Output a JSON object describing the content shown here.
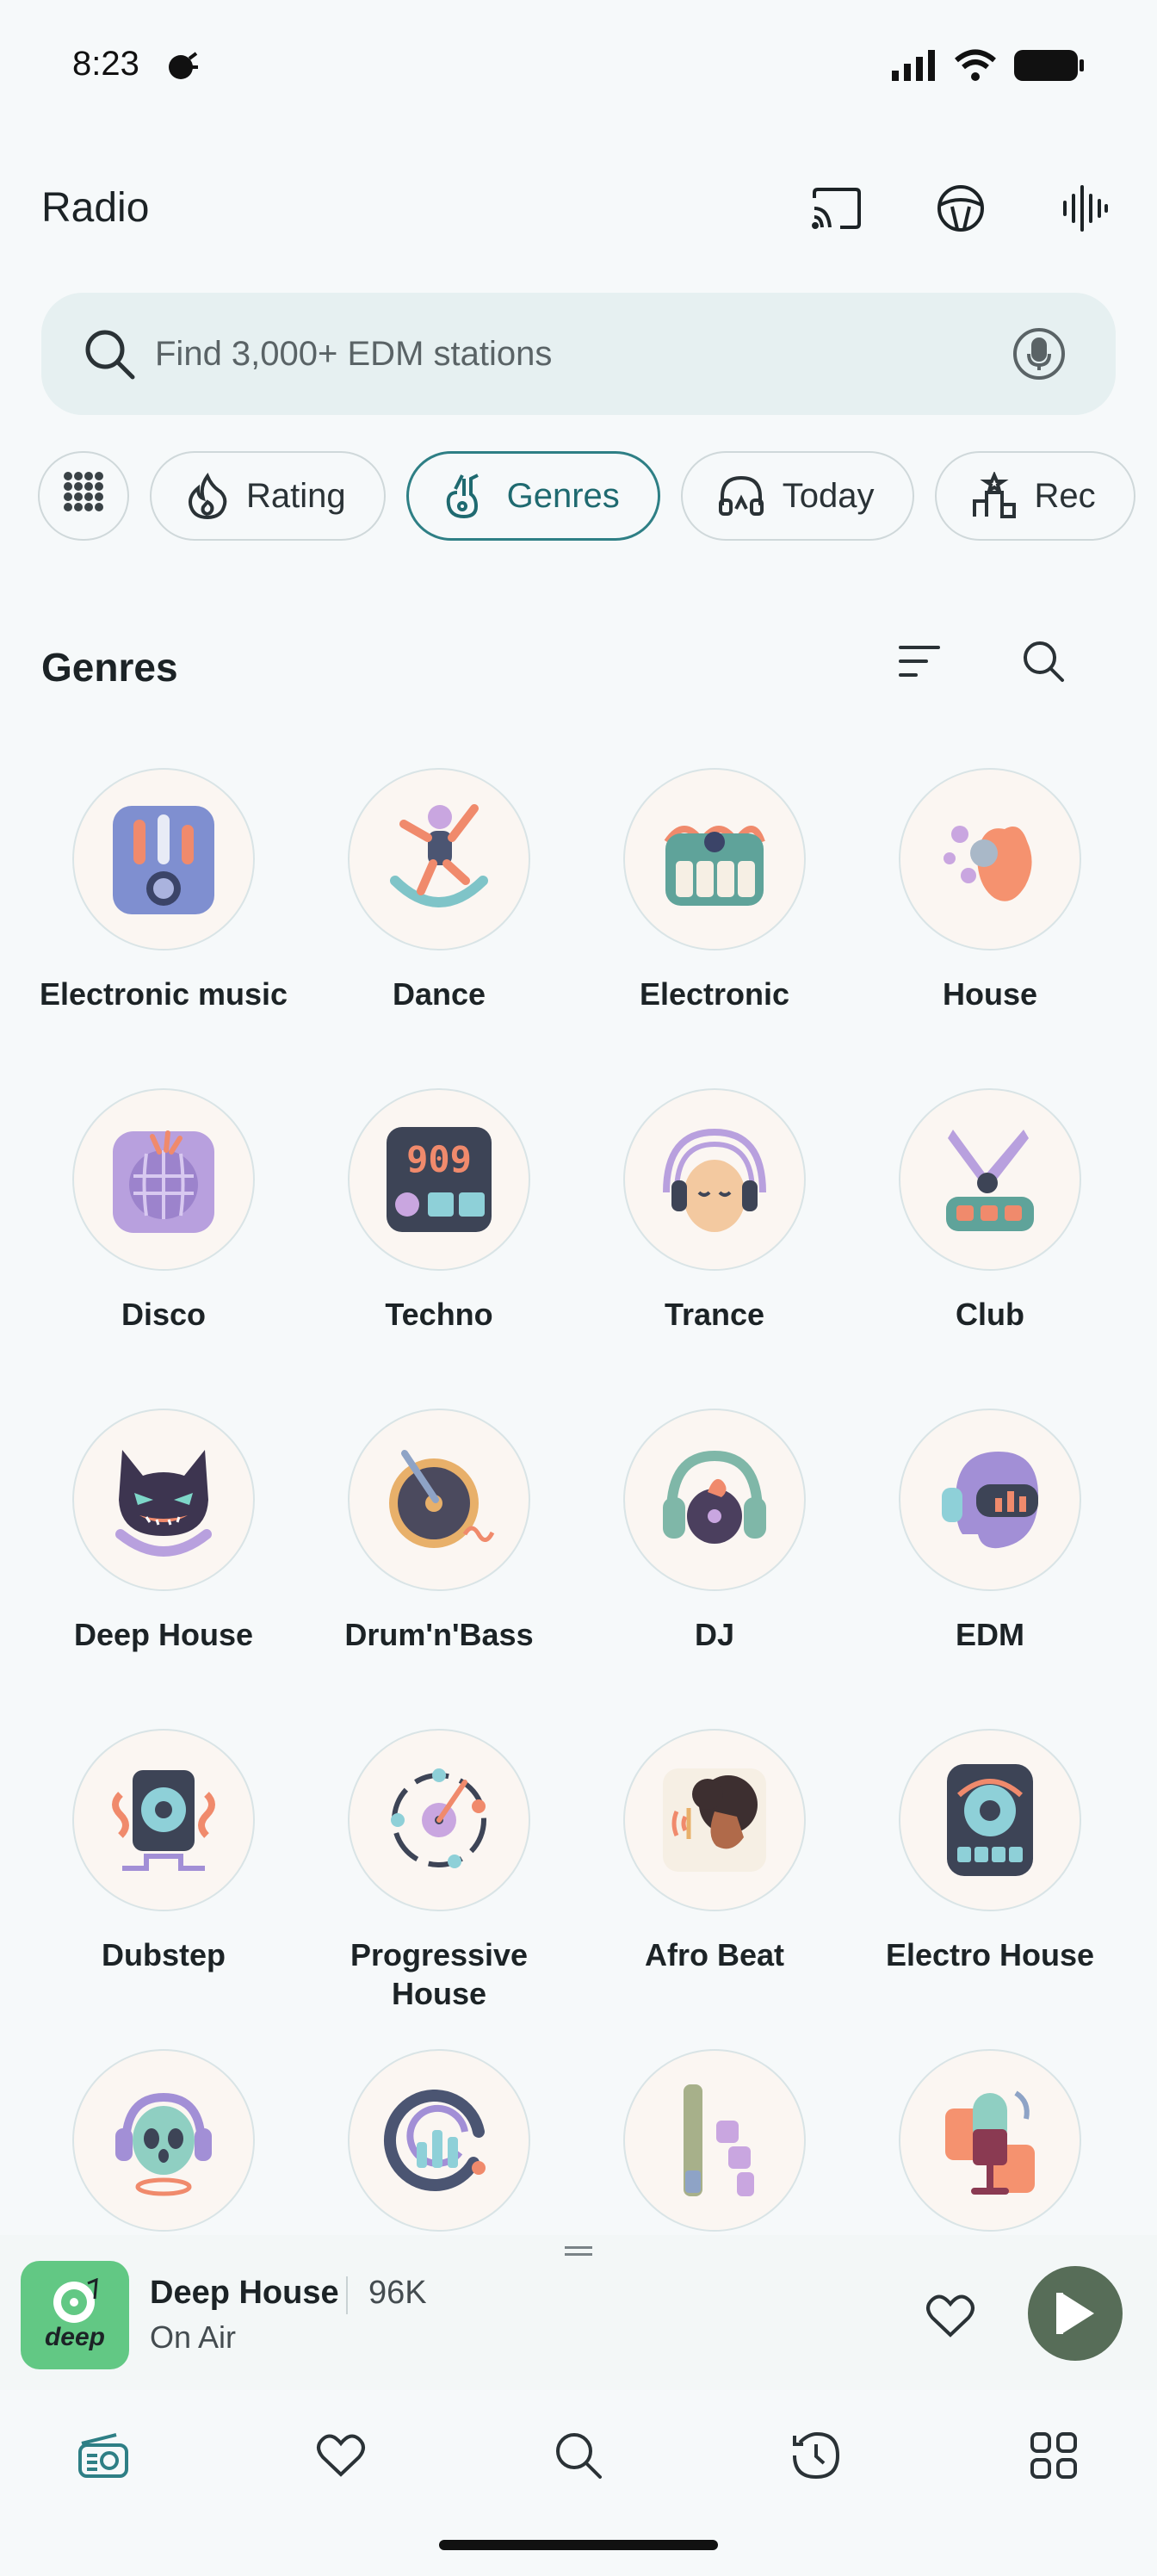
{
  "status_bar": {
    "time": "8:23"
  },
  "header": {
    "title": "Radio"
  },
  "search": {
    "placeholder": "Find 3,000+ EDM stations"
  },
  "chips": [
    {
      "label": "Rating",
      "icon": "flame-icon"
    },
    {
      "label": "Genres",
      "icon": "guitar-icon",
      "active": true
    },
    {
      "label": "Today",
      "icon": "headphones-icon"
    },
    {
      "label": "Rec",
      "icon": "podium-icon"
    }
  ],
  "section": {
    "title": "Genres"
  },
  "genres": [
    {
      "label": "Electronic music",
      "icon": "equalizer-speaker-icon"
    },
    {
      "label": "Dance",
      "icon": "dancer-icon"
    },
    {
      "label": "Electronic",
      "icon": "synth-keyboard-icon"
    },
    {
      "label": "House",
      "icon": "hand-snap-icon"
    },
    {
      "label": "Disco",
      "icon": "disco-ball-icon"
    },
    {
      "label": "Techno",
      "icon": "drum-machine-909-icon"
    },
    {
      "label": "Trance",
      "icon": "face-headphones-icon"
    },
    {
      "label": "Club",
      "icon": "dj-booth-icon"
    },
    {
      "label": "Deep House",
      "icon": "cat-face-icon"
    },
    {
      "label": "Drum'n'Bass",
      "icon": "vinyl-player-icon"
    },
    {
      "label": "DJ",
      "icon": "dj-headphones-icon"
    },
    {
      "label": "EDM",
      "icon": "robot-helmet-icon"
    },
    {
      "label": "Dubstep",
      "icon": "subwoofer-icon"
    },
    {
      "label": "Progressive House",
      "icon": "orbit-record-icon"
    },
    {
      "label": "Afro Beat",
      "icon": "afro-portrait-icon"
    },
    {
      "label": "Electro House",
      "icon": "speaker-icon"
    },
    {
      "label": "",
      "icon": "alien-headphones-icon"
    },
    {
      "label": "",
      "icon": "signal-bars-icon"
    },
    {
      "label": "",
      "icon": "mixer-sliders-icon"
    },
    {
      "label": "",
      "icon": "microphone-icon"
    }
  ],
  "player": {
    "station": "Deep House",
    "listeners": "96K",
    "status": "On Air",
    "art_text": "deep"
  },
  "bottom_nav": [
    {
      "name": "radio-icon"
    },
    {
      "name": "favorites-icon"
    },
    {
      "name": "search-icon"
    },
    {
      "name": "history-icon"
    },
    {
      "name": "apps-icon"
    }
  ],
  "colors": {
    "accent": "#2e7f85",
    "play_button": "#576d58",
    "art_bg": "#62c884"
  }
}
